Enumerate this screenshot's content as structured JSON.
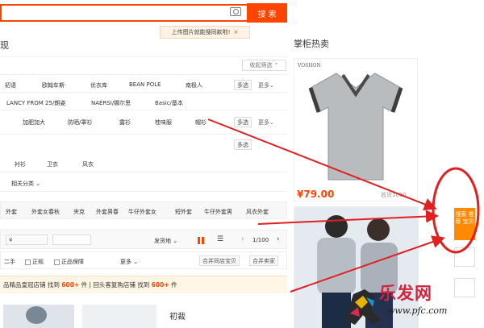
{
  "search": {
    "button": "搜 索",
    "tip": "上传图片就能搜同款啦!",
    "tip_close": "×"
  },
  "section_title": "现",
  "right_title": "掌柜热卖",
  "filters": {
    "collapse_label": "收起筛选 ⌃",
    "row1": [
      "初语",
      "欧翰车斯·",
      "优衣库",
      "BEAN POLE",
      "南极人"
    ],
    "row2": [
      "LANCY FROM 25/朗姿",
      "NAERSI/娜尔思",
      "Basic/基本"
    ],
    "row3": [
      "加肥加大",
      "防晒/罩衫",
      "露衫",
      "桂味服",
      "帽衫"
    ],
    "multi": "多选",
    "more": "更多⌄",
    "row4": [
      "衬衫",
      "卫衣",
      "风衣"
    ],
    "row5": "相关分类 ⌄",
    "row6": [
      "外套",
      "外套女春秋",
      "夹克",
      "外套男春",
      "牛仔外套女",
      "短外套",
      "牛仔外套男",
      "风衣外套"
    ]
  },
  "sortbar": {
    "input": "¥",
    "shipping": "发货地 ⌄",
    "page": "1/100"
  },
  "filterbar": {
    "items": [
      "二手",
      "正规",
      "正品保障"
    ],
    "more": "更多 ⌄",
    "btn1": "合并同店宝贝",
    "btn2": "合并卖家"
  },
  "banner": {
    "a": "品精品皇冠店铺",
    "b": "找到",
    "c": "600+",
    "d": "件",
    "e": "| 回头客复购店铺",
    "f": "找到",
    "g": "600+",
    "h": "件"
  },
  "cards": {
    "label": "初裁"
  },
  "products": [
    {
      "brand": "VOSHON",
      "price": "¥79.00",
      "sold": "收货1000"
    }
  ],
  "side": {
    "label": "搜索 推荐 宝贝"
  },
  "watermark": {
    "text": "乐发网",
    "url": "www.pfc.com"
  },
  "colors": {
    "accent": "#ff4400",
    "annotation": "#e02020"
  }
}
